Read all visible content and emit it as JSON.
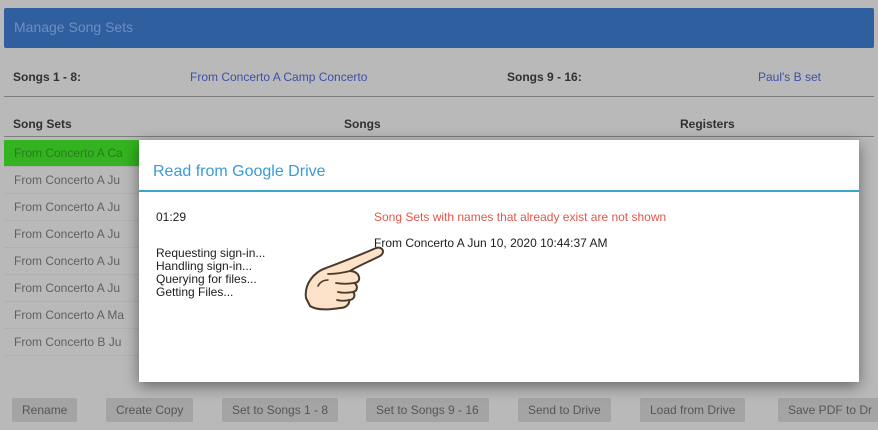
{
  "window": {
    "title": "Manage Song Sets"
  },
  "header": {
    "songs_1_8_label": "Songs 1 - 8:",
    "songs_1_8_value": "From Concerto A Camp Concerto",
    "songs_9_16_label": "Songs 9 - 16:",
    "songs_9_16_value": "Paul's B set"
  },
  "columns": {
    "song_sets": "Song Sets",
    "songs": "Songs",
    "registers": "Registers"
  },
  "song_sets": [
    {
      "label": "From Concerto A Ca",
      "selected": true
    },
    {
      "label": "From Concerto A Ju",
      "selected": false
    },
    {
      "label": "From Concerto A Ju",
      "selected": false
    },
    {
      "label": "From Concerto A Ju",
      "selected": false
    },
    {
      "label": "From Concerto A Ju",
      "selected": false
    },
    {
      "label": "From Concerto A Ju",
      "selected": false
    },
    {
      "label": "From Concerto A Ma",
      "selected": false
    },
    {
      "label": "From Concerto B Ju",
      "selected": false
    }
  ],
  "toolbar": {
    "rename": "Rename",
    "create_copy": "Create Copy",
    "set_songs_1_8": "Set to Songs 1 - 8",
    "set_songs_9_16": "Set to Songs 9 - 16",
    "send_to_drive": "Send to Drive",
    "load_from_drive": "Load from Drive",
    "save_pdf": "Save PDF to Dr"
  },
  "dialog": {
    "title": "Read from Google Drive",
    "timer": "01:29",
    "status_lines": [
      "Requesting sign-in...",
      "Handling sign-in...",
      "Querying for files...",
      "Getting Files..."
    ],
    "warning": "Song Sets with names that already exist are not shown",
    "files": [
      "From Concerto A Jun 10, 2020 10:44:37 AM"
    ]
  },
  "colors": {
    "selected_row": "#33b31f",
    "dialog_accent": "#3a9bd6",
    "warning_text": "#e0584a",
    "title_bar": "#2f5f9e"
  },
  "icons": {
    "pointer": "hand-pointer-icon"
  }
}
